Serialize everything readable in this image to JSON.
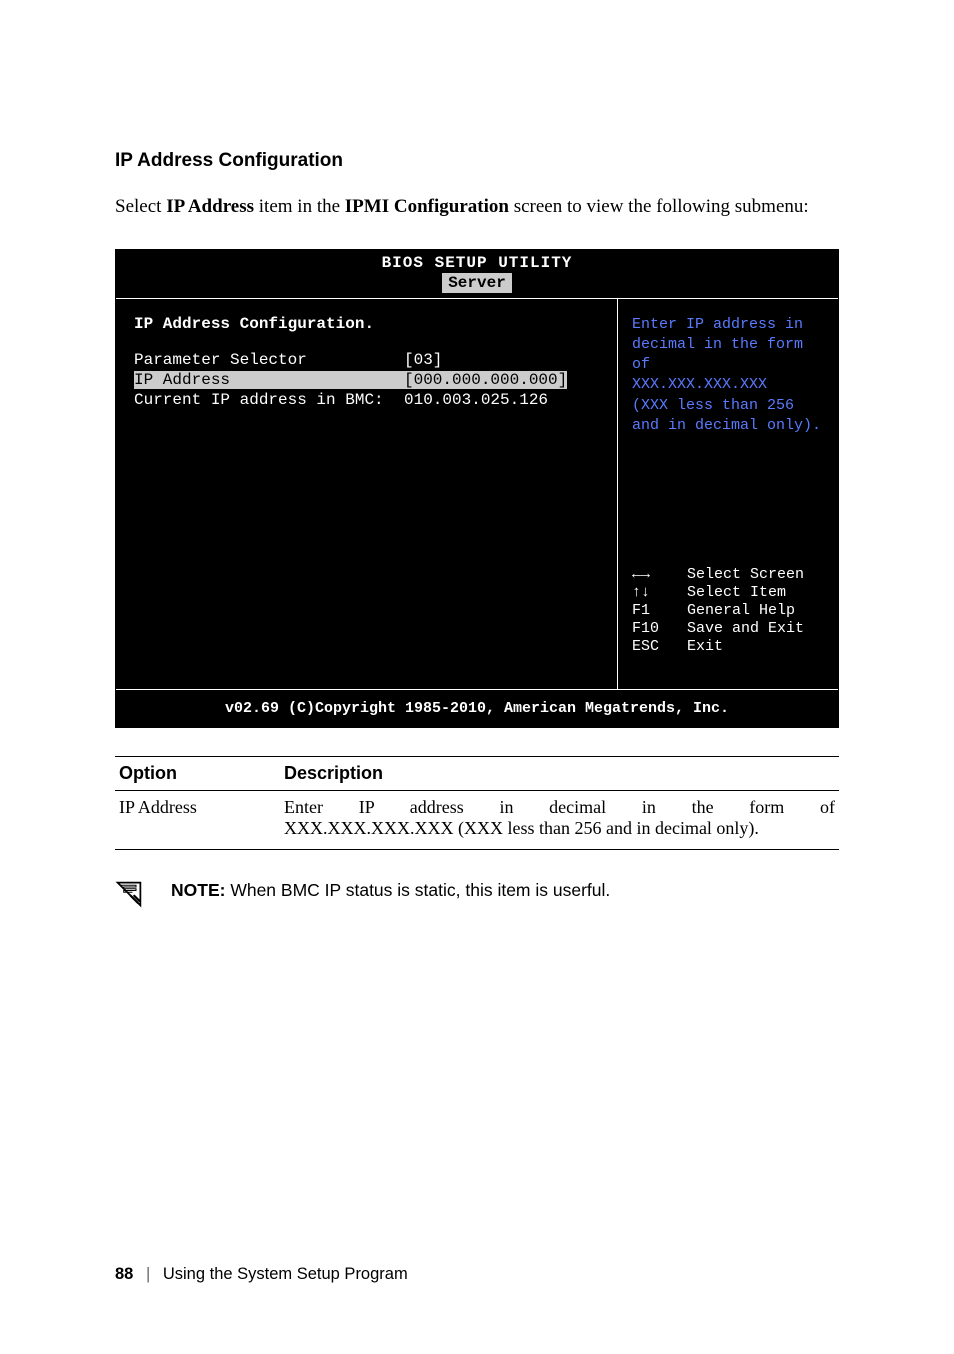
{
  "heading": "IP Address Configuration",
  "intro": {
    "pre": "Select ",
    "b1": "IP Address",
    "mid": " item in the ",
    "b2": "IPMI Configuration",
    "post": " screen to view the following submenu:"
  },
  "bios": {
    "title": "BIOS SETUP UTILITY",
    "tab": "Server",
    "panel_title": "IP Address Configuration.",
    "rows": [
      {
        "label": "Parameter Selector",
        "value": "[03]"
      },
      {
        "label": "IP Address",
        "value": "[000.000.000.000]"
      },
      {
        "label": "Current IP address in BMC:",
        "value": "010.003.025.126"
      }
    ],
    "help_lines": [
      "Enter IP address in",
      "decimal in the form of",
      "XXX.XXX.XXX.XXX",
      "(XXX less than 256",
      "and in decimal only)."
    ],
    "keys": [
      {
        "k": "←→",
        "d": "Select Screen"
      },
      {
        "k": "↑↓",
        "d": "Select Item"
      },
      {
        "k": "F1",
        "d": "General Help"
      },
      {
        "k": "F10",
        "d": "Save and Exit"
      },
      {
        "k": "ESC",
        "d": "Exit"
      }
    ],
    "footer": "v02.69 (C)Copyright 1985-2010, American Megatrends, Inc."
  },
  "table": {
    "headers": [
      "Option",
      "Description"
    ],
    "rows": [
      {
        "option": "IP Address",
        "desc_line1": "Enter IP address in decimal in the form of",
        "desc_line2": "XXX.XXX.XXX.XXX (XXX less than 256 and in decimal only)."
      }
    ]
  },
  "note": {
    "label": "NOTE:",
    "text": " When BMC IP status is static, this item is userful."
  },
  "footer": {
    "page": "88",
    "section": "Using the System Setup Program"
  }
}
